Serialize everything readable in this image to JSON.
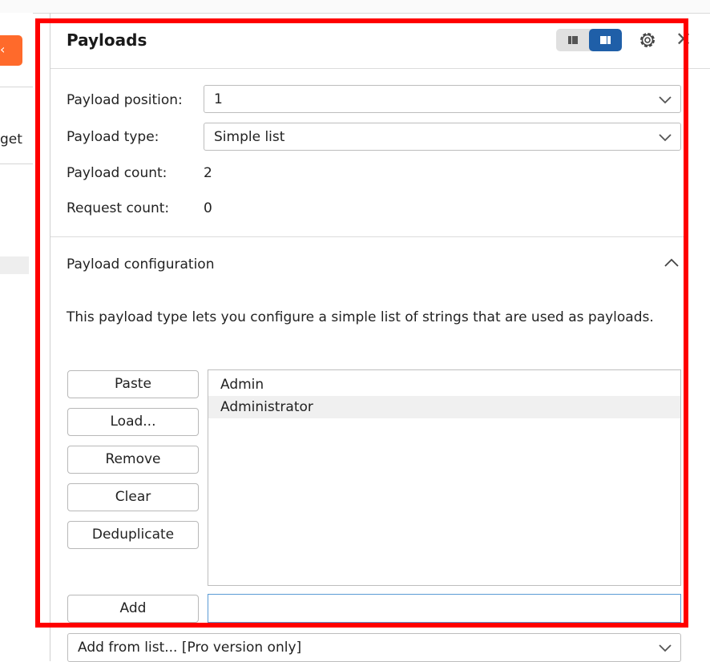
{
  "left_pane": {
    "partial_text": "get"
  },
  "panel": {
    "title": "Payloads",
    "payload_position_label": "Payload position:",
    "payload_position_value": "1",
    "payload_type_label": "Payload type:",
    "payload_type_value": "Simple list",
    "payload_count_label": "Payload count:",
    "payload_count_value": "2",
    "request_count_label": "Request count:",
    "request_count_value": "0"
  },
  "config": {
    "title": "Payload configuration",
    "description": "This payload type lets you configure a simple list of strings that are used as payloads.",
    "buttons": [
      "Paste",
      "Load...",
      "Remove",
      "Clear",
      "Deduplicate"
    ],
    "list_items": [
      "Admin",
      "Administrator"
    ],
    "add_button": "Add",
    "add_input_value": "",
    "add_from_list": "Add from list... [Pro version only]"
  },
  "colors": {
    "highlight": "#ff0000",
    "accent_blue": "#1f5fa8",
    "orange": "#ff6a2b"
  }
}
